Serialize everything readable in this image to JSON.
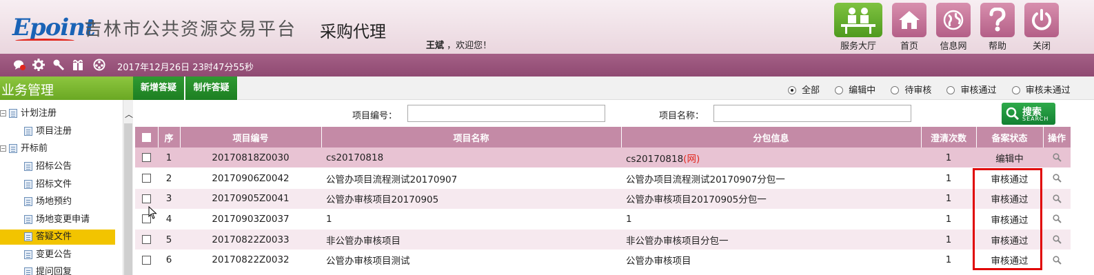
{
  "header": {
    "logo_text": "Epoint",
    "platform_name": "吉林市公共资源交易平台",
    "module_name": "采购代理",
    "user_name": "王斌",
    "welcome_suffix": "，欢迎您！",
    "nav": [
      {
        "label": "服务大厅",
        "icon": "service-hall-icon"
      },
      {
        "label": "首页",
        "icon": "home-icon"
      },
      {
        "label": "信息网",
        "icon": "globe-icon"
      },
      {
        "label": "帮助",
        "icon": "help-icon"
      },
      {
        "label": "关闭",
        "icon": "power-icon"
      }
    ]
  },
  "strip": {
    "icons": [
      "message-icon",
      "settings-gear-icon",
      "tools-icon",
      "gift-icon",
      "palette-icon"
    ],
    "datetime": "2017年12月26日 23时47分55秒"
  },
  "sidebar": {
    "title": "业务管理",
    "tree": [
      {
        "label": "计划注册",
        "level": 0,
        "expander": "⊟"
      },
      {
        "label": "项目注册",
        "level": 1
      },
      {
        "label": "开标前",
        "level": 0,
        "expander": "⊟"
      },
      {
        "label": "招标公告",
        "level": 1
      },
      {
        "label": "招标文件",
        "level": 1
      },
      {
        "label": "场地预约",
        "level": 1
      },
      {
        "label": "场地变更申请",
        "level": 1
      },
      {
        "label": "答疑文件",
        "level": 1,
        "selected": true
      },
      {
        "label": "变更公告",
        "level": 1
      },
      {
        "label": "提问回复",
        "level": 1
      }
    ]
  },
  "toolbar": {
    "add_label": "新增答疑",
    "make_label": "制作答疑",
    "filters": [
      {
        "label": "全部",
        "checked": true
      },
      {
        "label": "编辑中",
        "checked": false
      },
      {
        "label": "待审核",
        "checked": false
      },
      {
        "label": "审核通过",
        "checked": false
      },
      {
        "label": "审核未通过",
        "checked": false
      }
    ]
  },
  "search": {
    "project_no_label": "项目编号：",
    "project_no_value": "",
    "project_name_label": "项目名称：",
    "project_name_value": "",
    "button_zh": "搜索",
    "button_en": "SEARCH"
  },
  "table": {
    "headers": [
      "",
      "序",
      "项目编号",
      "项目名称",
      "分包信息",
      "澄清次数",
      "备案状态",
      "操作"
    ],
    "rows": [
      {
        "no": "1",
        "code": "20170818Z0030",
        "name": "cs20170818",
        "package": "cs20170818",
        "package_tag": "(网)",
        "times": "1",
        "status": "编辑中"
      },
      {
        "no": "2",
        "code": "20170906Z0042",
        "name": "公管办项目流程测试20170907",
        "package": "公管办项目流程测试20170907分包一",
        "package_tag": "",
        "times": "1",
        "status": "审核通过"
      },
      {
        "no": "3",
        "code": "20170905Z0041",
        "name": "公管办审核项目20170905",
        "package": "公管办审核项目20170905分包一",
        "package_tag": "",
        "times": "1",
        "status": "审核通过"
      },
      {
        "no": "4",
        "code": "20170903Z0037",
        "name": "1",
        "package": "1",
        "package_tag": "",
        "times": "1",
        "status": "审核通过"
      },
      {
        "no": "5",
        "code": "20170822Z0033",
        "name": "非公管办审核项目",
        "package": "非公管办审核项目分包一",
        "package_tag": "",
        "times": "1",
        "status": "审核通过"
      },
      {
        "no": "6",
        "code": "20170822Z0032",
        "name": "公管办审核项目测试",
        "package": "公管办审核项目",
        "package_tag": "",
        "times": "1",
        "status": "审核通过"
      }
    ]
  },
  "colors": {
    "header_bg": "#ead6de",
    "strip_bg": "#9a5580",
    "sidebar_title_bg": "#7bb833",
    "action_button_bg": "#1f8a26",
    "table_header_bg": "#c48aa6",
    "selected_row_bg": "#e8c3d3",
    "highlight_box": "#e00000"
  }
}
